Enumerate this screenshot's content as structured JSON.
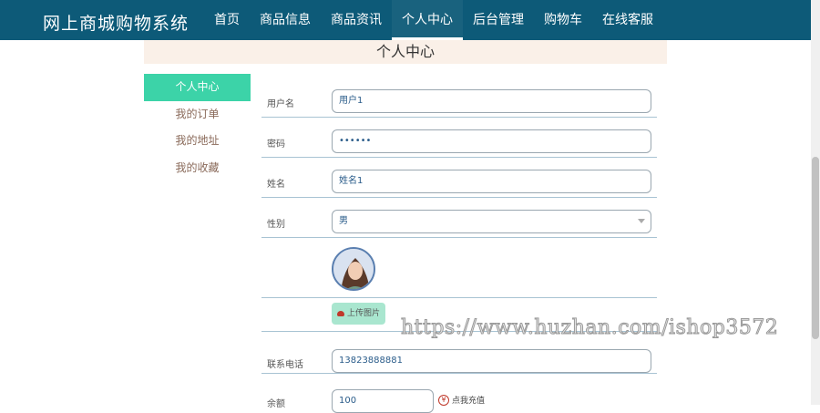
{
  "app": {
    "title": "网上商城购物系统"
  },
  "nav": {
    "items": [
      {
        "label": "首页"
      },
      {
        "label": "商品信息"
      },
      {
        "label": "商品资讯"
      },
      {
        "label": "个人中心",
        "active": true
      },
      {
        "label": "后台管理"
      },
      {
        "label": "购物车"
      },
      {
        "label": "在线客服"
      }
    ]
  },
  "page": {
    "title": "个人中心"
  },
  "sidebar": {
    "items": [
      {
        "label": "个人中心",
        "active": true
      },
      {
        "label": "我的订单"
      },
      {
        "label": "我的地址"
      },
      {
        "label": "我的收藏"
      }
    ]
  },
  "form": {
    "username": {
      "label": "用户名",
      "value": "用户1"
    },
    "password": {
      "label": "密码",
      "value": "••••••"
    },
    "name": {
      "label": "姓名",
      "value": "姓名1"
    },
    "gender": {
      "label": "性别",
      "value": "男"
    },
    "upload": {
      "label": "上传图片"
    },
    "phone": {
      "label": "联系电话",
      "value": "13823888881"
    },
    "balance": {
      "label": "余额",
      "value": "100"
    },
    "recharge": {
      "label": "点我充值",
      "symbol": "¥"
    }
  },
  "watermark": {
    "text": "https://www.huzhan.com/ishop3572"
  },
  "colors": {
    "topbar": "#0d5a78",
    "accent": "#3cd3a8",
    "title_band": "#faf0e8"
  }
}
